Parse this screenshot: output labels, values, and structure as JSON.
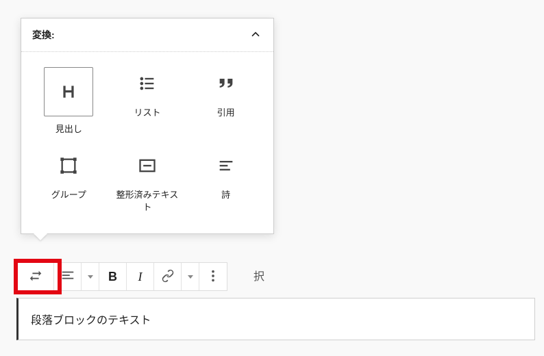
{
  "popover": {
    "title": "変換:",
    "items": [
      {
        "id": "heading",
        "label": "見出し",
        "selected": true
      },
      {
        "id": "list",
        "label": "リスト",
        "selected": false
      },
      {
        "id": "quote",
        "label": "引用",
        "selected": false
      },
      {
        "id": "group",
        "label": "グループ",
        "selected": false
      },
      {
        "id": "preformatted",
        "label": "整形済みテキスト",
        "selected": false
      },
      {
        "id": "verse",
        "label": "詩",
        "selected": false
      }
    ]
  },
  "toolbar": {
    "bold": "B",
    "italic": "I"
  },
  "bg_text": "択",
  "paragraph": {
    "text": "段落ブロックのテキスト"
  }
}
